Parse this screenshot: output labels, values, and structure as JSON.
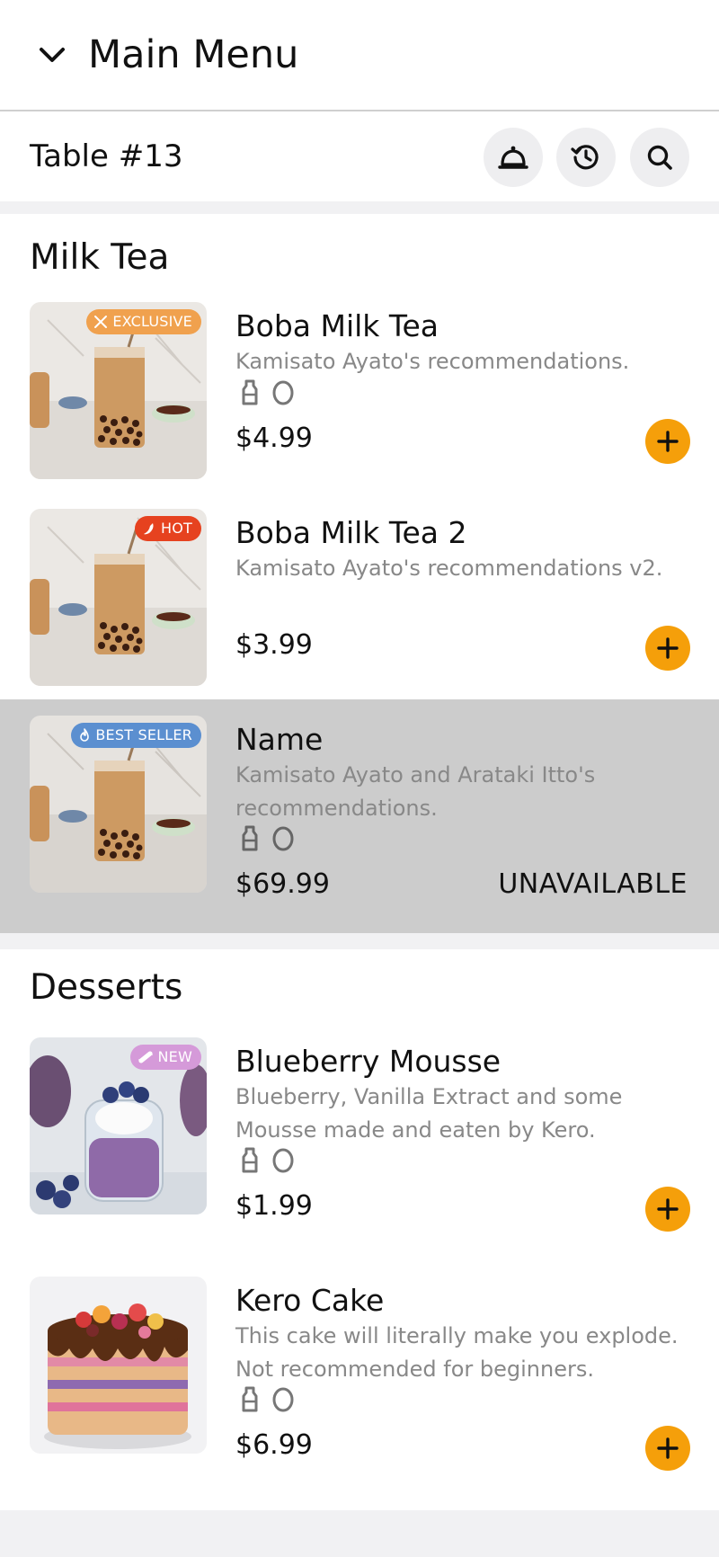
{
  "header": {
    "title": "Main Menu",
    "back_icon": "chevron-down-icon"
  },
  "tablebar": {
    "table_name": "Table #13",
    "buttons": [
      {
        "name": "call-waiter",
        "icon": "service-bell-icon"
      },
      {
        "name": "order-history",
        "icon": "history-icon"
      },
      {
        "name": "search",
        "icon": "search-icon"
      }
    ]
  },
  "colors": {
    "accent": "#f59f0a",
    "exclusive": "#f0a14e",
    "hot": "#e6421f",
    "best_seller": "#5b8fd0",
    "new": "#d59ad9",
    "unavailable_bg": "#cccccc"
  },
  "sections": [
    {
      "title": "Milk Tea",
      "items": [
        {
          "name": "Boba Milk Tea",
          "desc": "Kamisato Ayato's recommendations.",
          "price": "$4.99",
          "badge": "EXCLUSIVE",
          "available": true
        },
        {
          "name": "Boba Milk Tea 2",
          "desc": "Kamisato Ayato's recommendations v2.",
          "price": "$3.99",
          "badge": "HOT",
          "available": true
        },
        {
          "name": "Name",
          "desc": "Kamisato Ayato and Arataki Itto's recommendations.",
          "price": "$69.99",
          "badge": "BEST SELLER",
          "available": false,
          "status": "UNAVAILABLE"
        }
      ]
    },
    {
      "title": "Desserts",
      "items": [
        {
          "name": "Blueberry Mousse",
          "desc": "Blueberry, Vanilla Extract and some Mousse made and eaten by Kero.",
          "price": "$1.99",
          "badge": "NEW",
          "available": true
        },
        {
          "name": "Kero Cake",
          "desc": "This cake will literally make you explode. Not recommended for beginners.",
          "price": "$6.99",
          "available": true
        }
      ]
    }
  ]
}
